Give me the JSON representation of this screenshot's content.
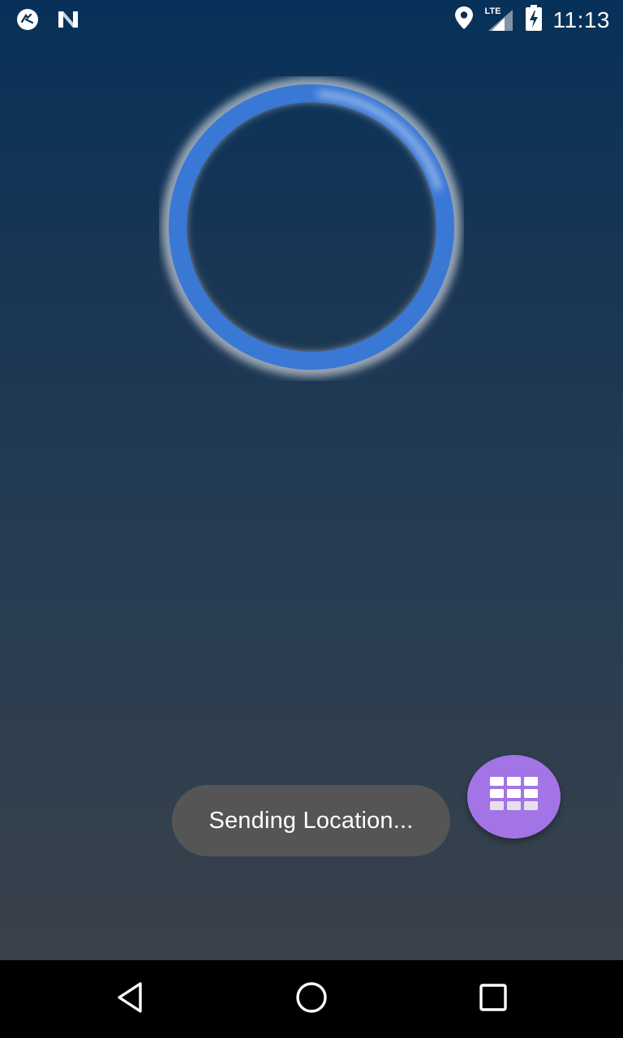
{
  "status_bar": {
    "time": "11:13",
    "network": "LTE",
    "icons": [
      "app-notification-icon",
      "n-notification-icon",
      "location-icon",
      "signal-icon",
      "battery-charging-icon"
    ]
  },
  "loading_ring": {
    "color": "#3a78d6",
    "glow_color": "#ffffff"
  },
  "toast": {
    "message": "Sending Location..."
  },
  "fab": {
    "icon": "keypad-grid-icon",
    "color": "#a374e6"
  },
  "navigation": {
    "icons": [
      "back-icon",
      "home-icon",
      "recents-icon"
    ]
  }
}
